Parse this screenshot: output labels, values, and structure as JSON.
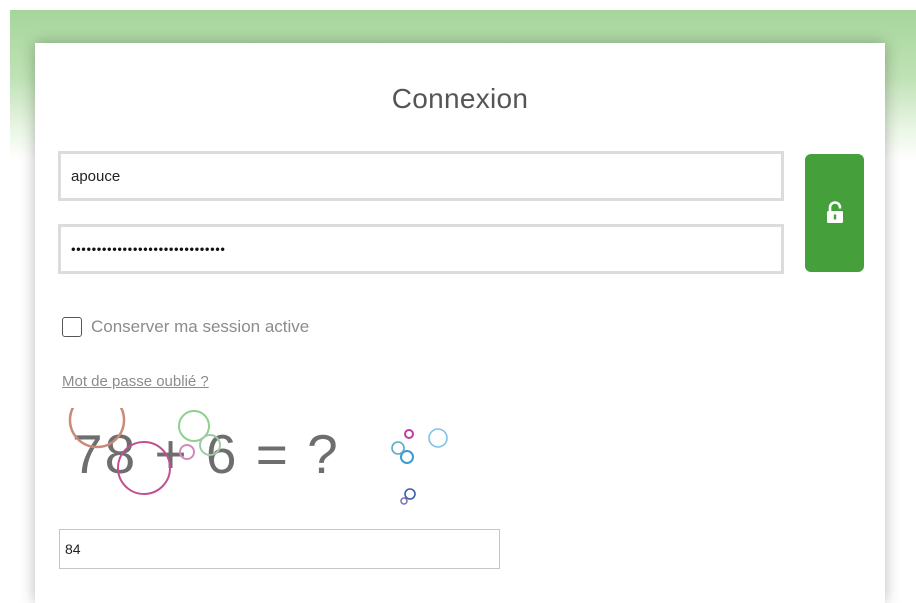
{
  "login": {
    "title": "Connexion",
    "username_value": "apouce",
    "password_mask": "••••••••••••••••••••••••••••••",
    "remember_label": "Conserver ma session active",
    "remember_checked": false,
    "forgot_label": "Mot de passe oublié ?",
    "captcha_text": "78 + 6 = ?",
    "captcha_answer": "84",
    "submit_icon": "unlock-icon"
  },
  "colors": {
    "accent_green": "#45a03b",
    "band_green": "#a6d59b",
    "muted_text": "#8c8c8c"
  }
}
